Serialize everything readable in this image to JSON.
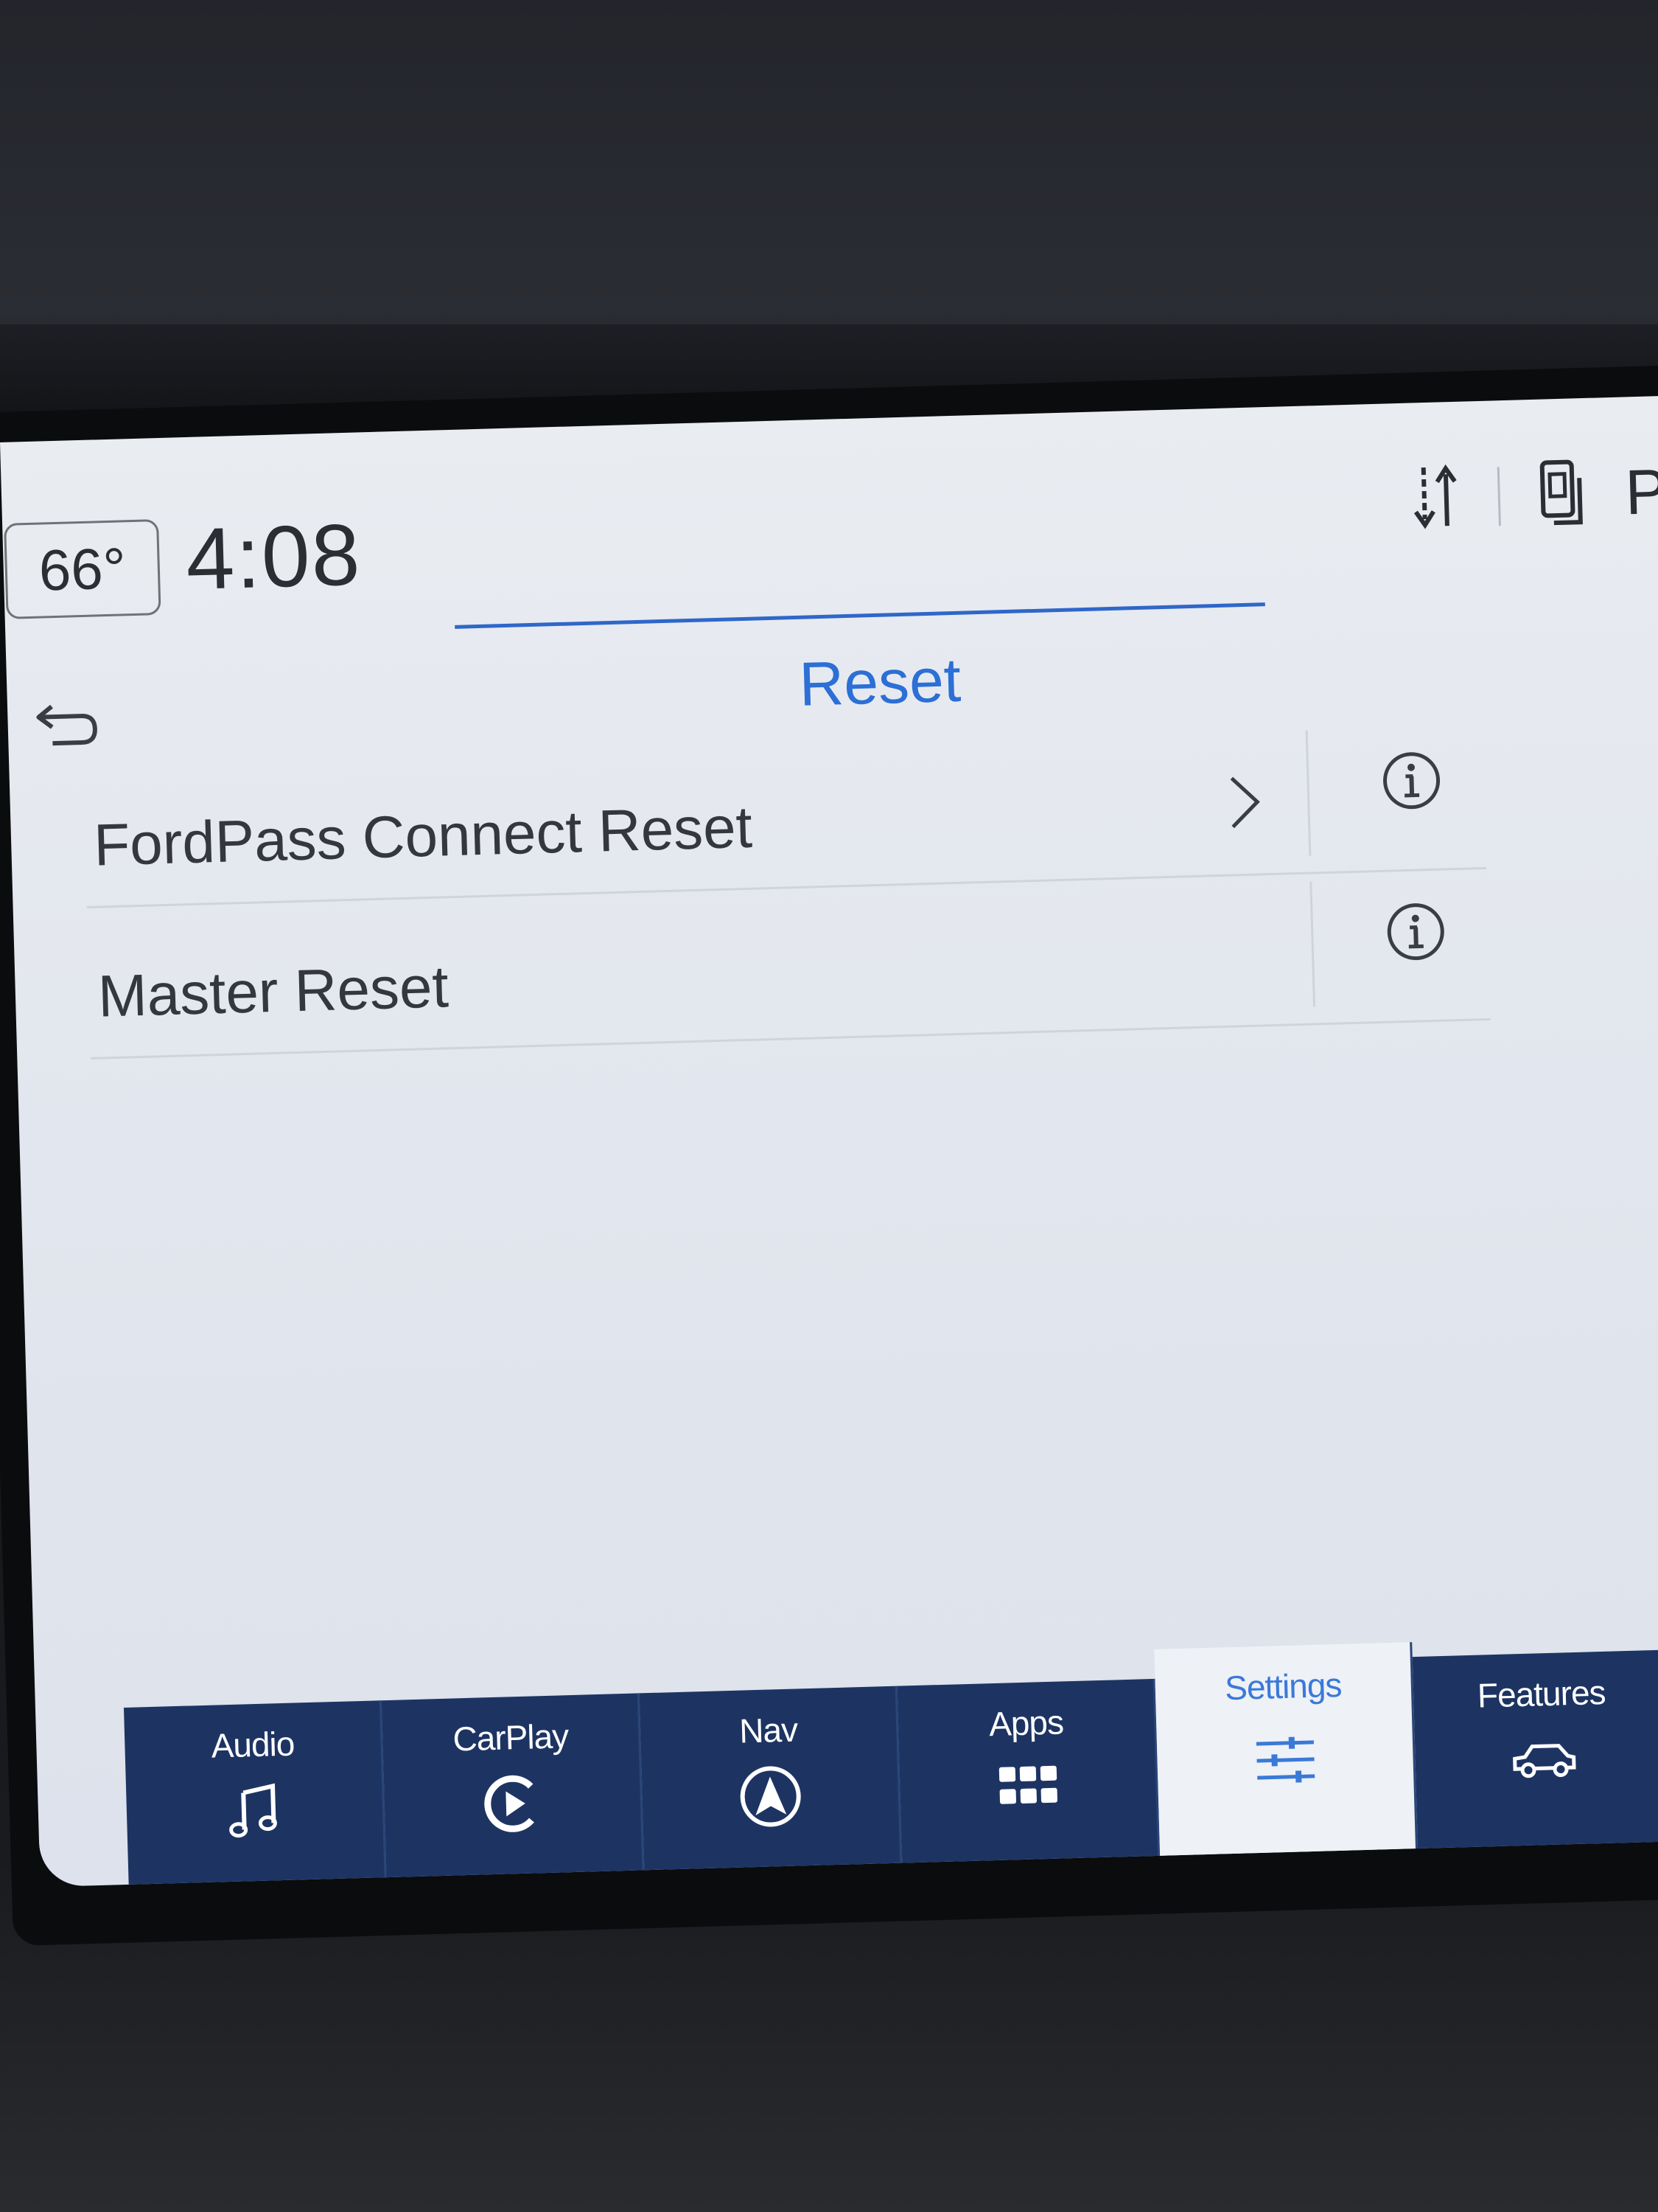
{
  "status_bar": {
    "temperature": "66°",
    "time": "4:08",
    "extra_label": "P"
  },
  "header": {
    "title": "Reset"
  },
  "list": {
    "items": [
      {
        "label": "FordPass Connect Reset",
        "has_chevron": true
      },
      {
        "label": "Master Reset",
        "has_chevron": false
      }
    ]
  },
  "navbar": {
    "tabs": [
      {
        "label": "Audio",
        "icon": "music-note-icon"
      },
      {
        "label": "CarPlay",
        "icon": "carplay-icon"
      },
      {
        "label": "Nav",
        "icon": "navigation-icon"
      },
      {
        "label": "Apps",
        "icon": "apps-grid-icon"
      },
      {
        "label": "Settings",
        "icon": "settings-sliders-icon",
        "active": true
      },
      {
        "label": "Features",
        "icon": "vehicle-icon"
      }
    ]
  },
  "colors": {
    "accent": "#2c6fd6",
    "navbar_bg": "#1d3463",
    "screen_bg": "#e6e9ef"
  }
}
